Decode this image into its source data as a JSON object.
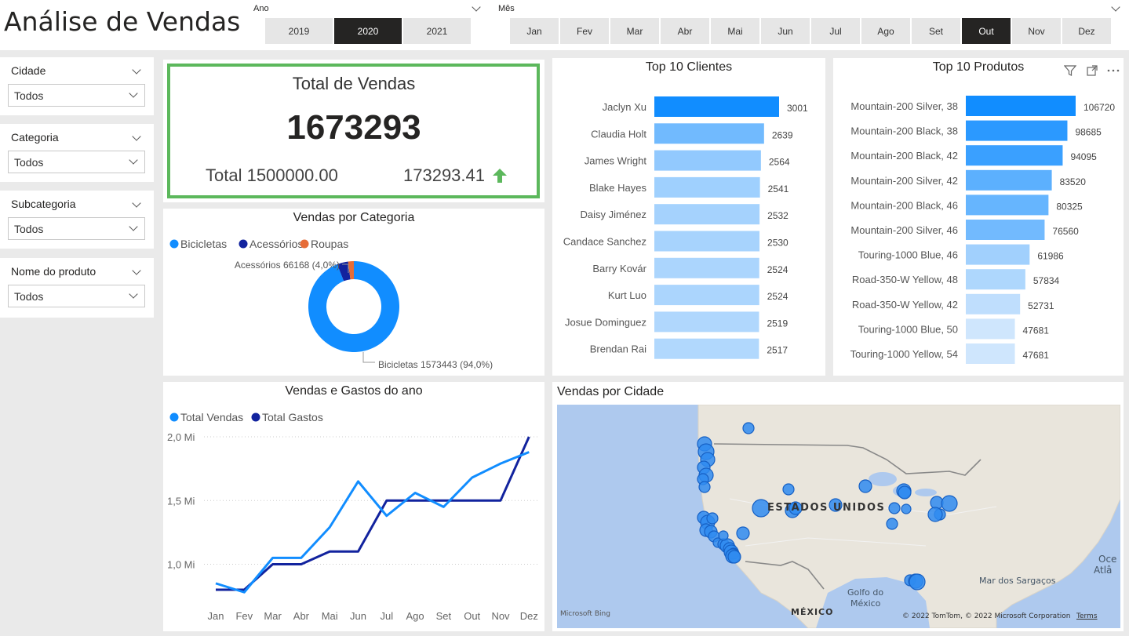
{
  "header": {
    "title": "Análise de Vendas",
    "year_slicer": {
      "label": "Ano",
      "options": [
        "2019",
        "2020",
        "2021"
      ],
      "selected": "2020"
    },
    "month_slicer": {
      "label": "Mês",
      "options": [
        "Jan",
        "Fev",
        "Mar",
        "Abr",
        "Mai",
        "Jun",
        "Jul",
        "Ago",
        "Set",
        "Out",
        "Nov",
        "Dez"
      ],
      "selected": "Out"
    }
  },
  "filters": [
    {
      "label": "Cidade",
      "value": "Todos"
    },
    {
      "label": "Categoria",
      "value": "Todos"
    },
    {
      "label": "Subcategoria",
      "value": "Todos"
    },
    {
      "label": "Nome do produto",
      "value": "Todos"
    }
  ],
  "kpi": {
    "title": "Total de Vendas",
    "value": "1673293",
    "target": "Total 1500000.00",
    "variance": "173293.41",
    "trend_color": "#5cb85c"
  },
  "colors": {
    "accent": "#118dff",
    "dark": "#12239e",
    "orange": "#e66c37",
    "kpi_border": "#5cb85c"
  },
  "chart_data": [
    {
      "type": "pie",
      "title": "Vendas por Categoria",
      "legend": [
        "Bicicletas",
        "Acessórios",
        "Roupas"
      ],
      "legend_position": "top-left",
      "categories": [
        "Bicicletas",
        "Acessórios",
        "Roupas"
      ],
      "values": [
        1573443,
        66168,
        33682
      ],
      "colors": [
        "#118dff",
        "#12239e",
        "#e66c37"
      ],
      "labels": [
        "Bicicletas 1573443 (94,0%)",
        "Acessórios 66168 (4,0%)"
      ]
    },
    {
      "type": "bar",
      "title": "Top 10 Clientes",
      "categories": [
        "Jaclyn Xu",
        "Claudia Holt",
        "James Wright",
        "Blake Hayes",
        "Daisy Jiménez",
        "Candace Sanchez",
        "Barry Kovár",
        "Kurt Luo",
        "Josue Dominguez",
        "Brendan Rai"
      ],
      "values": [
        3001,
        2639,
        2564,
        2541,
        2532,
        2530,
        2524,
        2524,
        2519,
        2517
      ],
      "orientation": "horizontal"
    },
    {
      "type": "bar",
      "title": "Top 10 Produtos",
      "categories": [
        "Mountain-200 Silver, 38",
        "Mountain-200 Black, 38",
        "Mountain-200 Black, 42",
        "Mountain-200 Silver, 42",
        "Mountain-200 Black, 46",
        "Mountain-200 Silver, 46",
        "Touring-1000 Blue, 46",
        "Road-350-W Yellow, 48",
        "Road-350-W Yellow, 42",
        "Touring-1000 Blue, 50",
        "Touring-1000 Yellow, 54"
      ],
      "values": [
        106720,
        98685,
        94095,
        83520,
        80325,
        76560,
        61986,
        57834,
        52731,
        47681,
        47681
      ],
      "orientation": "horizontal"
    },
    {
      "type": "line",
      "title": "Vendas e Gastos do ano",
      "categories": [
        "Jan",
        "Fev",
        "Mar",
        "Abr",
        "Mai",
        "Jun",
        "Jul",
        "Ago",
        "Set",
        "Out",
        "Nov",
        "Dez"
      ],
      "series": [
        {
          "name": "Total Vendas",
          "color": "#118dff",
          "values": [
            0.85,
            0.78,
            1.05,
            1.05,
            1.29,
            1.65,
            1.38,
            1.56,
            1.45,
            1.68,
            1.79,
            1.88
          ]
        },
        {
          "name": "Total Gastos",
          "color": "#12239e",
          "values": [
            0.8,
            0.8,
            1.0,
            1.0,
            1.1,
            1.1,
            1.5,
            1.5,
            1.5,
            1.5,
            1.5,
            2.0
          ]
        }
      ],
      "yticks": [
        "1,0 Mi",
        "1,5 Mi",
        "2,0 Mi"
      ],
      "ylim": [
        0.8,
        2.0
      ],
      "grid": true
    }
  ],
  "visual_icons": [
    "filter-icon",
    "focus-mode-icon",
    "more-options-icon"
  ],
  "map": {
    "title": "Vendas por Cidade",
    "labels": [
      "ESTADOS UNIDOS",
      "MÉXICO",
      "Golfo do",
      "México",
      "Mar dos Sargaços",
      "Oce",
      "Atlâ"
    ],
    "attribution": "© 2022 TomTom, © 2022 Microsoft Corporation",
    "terms": "Terms",
    "bing": "Microsoft Bing"
  }
}
